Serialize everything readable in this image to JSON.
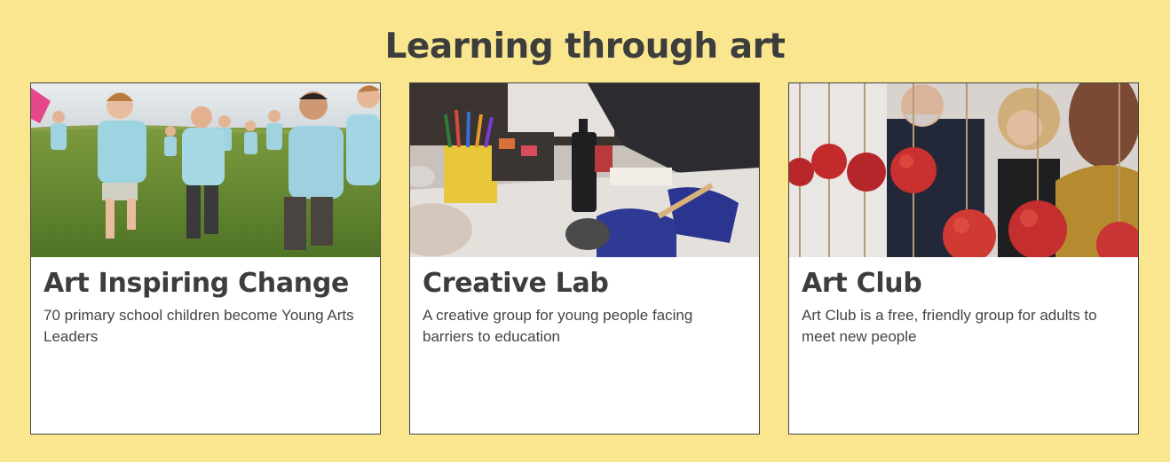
{
  "section": {
    "title": "Learning through art"
  },
  "cards": [
    {
      "title": "Art Inspiring Change",
      "description": "70 primary school children become Young Arts Leaders",
      "image_alt": "Children in light blue t-shirts running across a grassy field"
    },
    {
      "title": "Creative Lab",
      "description": "A creative group for young people facing barriers to education",
      "image_alt": "Young people working with art materials at a table"
    },
    {
      "title": "Art Club",
      "description": "Art Club is a free, friendly group for adults to meet new people",
      "image_alt": "Adults looking at an installation of red apples hanging on strings"
    }
  ],
  "colors": {
    "background": "#f9e68e",
    "heading": "#3d3d3d",
    "card_border": "#444444"
  }
}
